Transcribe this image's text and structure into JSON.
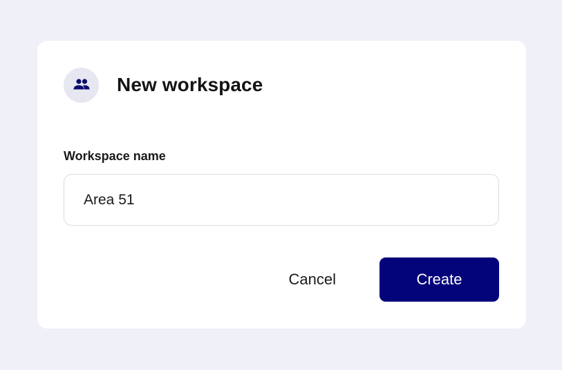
{
  "dialog": {
    "title": "New workspace",
    "icon": "users-icon"
  },
  "form": {
    "name_label": "Workspace name",
    "name_value": "Area 51",
    "name_placeholder": ""
  },
  "actions": {
    "cancel_label": "Cancel",
    "create_label": "Create"
  },
  "colors": {
    "background": "#eff0f8",
    "primary": "#03037a",
    "icon_bg": "#e7e7f1",
    "icon": "#0b0b6e"
  }
}
